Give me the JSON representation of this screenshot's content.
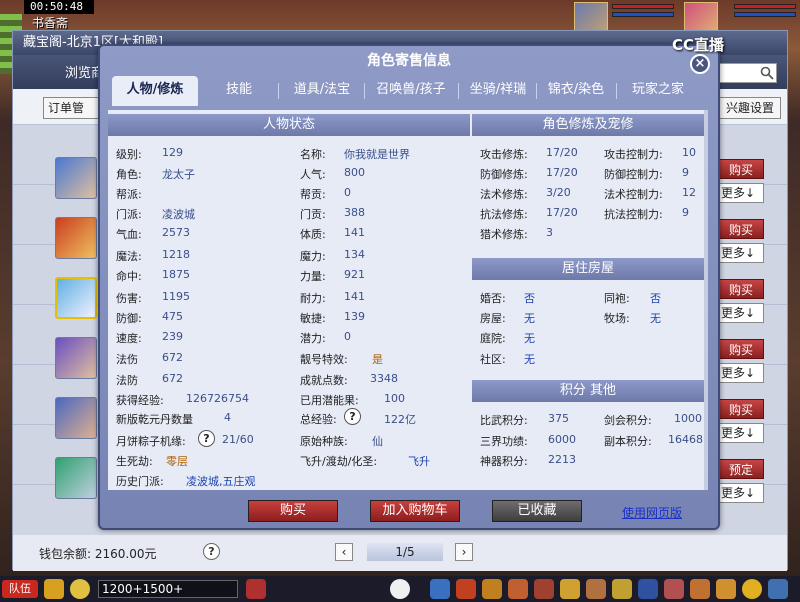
{
  "game": {
    "time": "00:50:48",
    "location": "书香斋"
  },
  "outer": {
    "window_title": "藏宝阁-北京1区[太和殿]",
    "browse_label": "浏览商",
    "order_btn": "订单管",
    "interest_btn": "兴趣设置",
    "side_buy": "购买",
    "side_more": "更多↓",
    "side_preset": "预定",
    "wallet_label": "钱包余额:",
    "wallet_value": "2160.00元",
    "help_icon": "?",
    "page": "1/5"
  },
  "modal": {
    "title": "角色寄售信息",
    "close": "×",
    "tabs": [
      "人物/修炼",
      "技能",
      "道具/法宝",
      "召唤兽/孩子",
      "坐骑/祥瑞",
      "锦衣/染色",
      "玩家之家"
    ],
    "status_panel": {
      "title": "人物状态",
      "left": [
        {
          "label": "级别:",
          "value": "129"
        },
        {
          "label": "角色:",
          "value": "龙太子"
        },
        {
          "label": "帮派:",
          "value": ""
        },
        {
          "label": "门派:",
          "value": "凌波城"
        },
        {
          "label": "气血:",
          "value": "2573"
        },
        {
          "label": "魔法:",
          "value": "1218"
        },
        {
          "label": "命中:",
          "value": "1875"
        },
        {
          "label": "伤害:",
          "value": "1195"
        },
        {
          "label": "防御:",
          "value": "475"
        },
        {
          "label": "速度:",
          "value": "239"
        },
        {
          "label": "法伤",
          "value": "672"
        },
        {
          "label": "法防",
          "value": "672"
        }
      ],
      "right": [
        {
          "label": "名称:",
          "value": "你我就是世界"
        },
        {
          "label": "人气:",
          "value": "800"
        },
        {
          "label": "帮贡:",
          "value": "0"
        },
        {
          "label": "门贡:",
          "value": "388"
        },
        {
          "label": "体质:",
          "value": "141"
        },
        {
          "label": "魔力:",
          "value": "134"
        },
        {
          "label": "力量:",
          "value": "921"
        },
        {
          "label": "耐力:",
          "value": "141"
        },
        {
          "label": "敏捷:",
          "value": "139"
        },
        {
          "label": "潜力:",
          "value": "0"
        },
        {
          "label": "靓号特效:",
          "value": "是"
        },
        {
          "label": "成就点数:",
          "value": "3348"
        }
      ],
      "exp_label": "获得经验:",
      "exp_value": "126726754",
      "used_potential_label": "已用潜能果:",
      "used_potential_value": "100",
      "qianyuan_label": "新版乾元丹数量",
      "qianyuan_value": "4",
      "total_exp_label": "总经验:",
      "total_exp_value": "122亿",
      "zongzi_label": "月饼粽子机缘:",
      "zongzi_value": "21/60",
      "origin_label": "原始种族:",
      "origin_value": "仙",
      "life_label": "生死劫:",
      "life_value": "零层",
      "fly_label": "飞升/渡劫/化圣:",
      "fly_value": "飞升",
      "history_label": "历史门派:",
      "history_value": "凌波城,五庄观",
      "q": "?"
    },
    "cultivation_panel": {
      "title": "角色修炼及宠修",
      "rows": [
        {
          "l1": "攻击修炼:",
          "v1": "17/20",
          "l2": "攻击控制力:",
          "v2": "10"
        },
        {
          "l1": "防御修炼:",
          "v1": "17/20",
          "l2": "防御控制力:",
          "v2": "9"
        },
        {
          "l1": "法术修炼:",
          "v1": "3/20",
          "l2": "法术控制力:",
          "v2": "12"
        },
        {
          "l1": "抗法修炼:",
          "v1": "17/20",
          "l2": "抗法控制力:",
          "v2": "9"
        },
        {
          "l1": "猎术修炼:",
          "v1": "3",
          "l2": "",
          "v2": ""
        }
      ]
    },
    "house_panel": {
      "title": "居住房屋",
      "rows": [
        {
          "l1": "婚否:",
          "v1": "否",
          "l2": "同袍:",
          "v2": "否"
        },
        {
          "l1": "房屋:",
          "v1": "无",
          "l2": "牧场:",
          "v2": "无"
        },
        {
          "l1": "庭院:",
          "v1": "无",
          "l2": "",
          "v2": ""
        },
        {
          "l1": "社区:",
          "v1": "无",
          "l2": "",
          "v2": ""
        }
      ]
    },
    "points_panel": {
      "title": "积分 其他",
      "rows": [
        {
          "l1": "比武积分:",
          "v1": "375",
          "l2": "剑会积分:",
          "v2": "1000"
        },
        {
          "l1": "三界功绩:",
          "v1": "6000",
          "l2": "副本积分:",
          "v2": "16468"
        },
        {
          "l1": "神器积分:",
          "v1": "2213",
          "l2": "",
          "v2": ""
        }
      ]
    },
    "actions": {
      "buy": "购买",
      "cart": "加入购物车",
      "favorited": "已收藏",
      "web_link": "使用网页版"
    }
  },
  "bottom": {
    "team": "队伍",
    "chat_value": "1200+1500+"
  },
  "watermark": "CC直播"
}
